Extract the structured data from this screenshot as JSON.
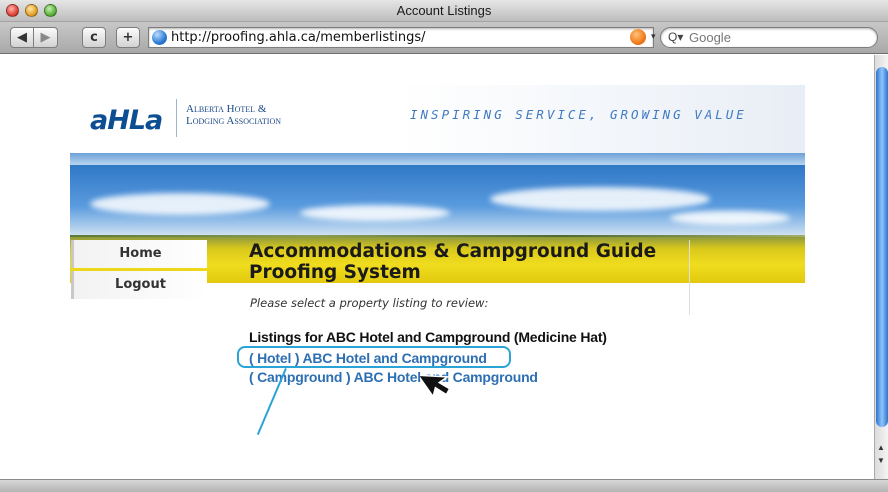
{
  "window": {
    "title": "Account Listings"
  },
  "toolbar": {
    "back_label": "◀",
    "forward_label": "▶",
    "reload_label": "c",
    "add_label": "+",
    "url": "http://proofing.ahla.ca/memberlistings/",
    "search_placeholder": "Google"
  },
  "site": {
    "logo_text": "aHLa",
    "org_name_line1": "Alberta Hotel &",
    "org_name_line2": "Lodging Association",
    "tagline": "INSPIRING SERVICE, GROWING VALUE"
  },
  "nav": {
    "items": [
      {
        "label": "Home"
      },
      {
        "label": "Logout"
      }
    ]
  },
  "main": {
    "title": "Accommodations & Campground Guide Proofing System",
    "subtitle": "Please select a property listing to review:",
    "listing_heading": "Listings for ABC Hotel and Campground (Medicine Hat)",
    "listings": [
      {
        "label": "( Hotel ) ABC Hotel and Campground"
      },
      {
        "label": "( Campground ) ABC Hotel and Campground"
      }
    ]
  },
  "colors": {
    "link": "#2d6fb3",
    "annotation": "#2aa3d6",
    "brand_blue": "#0d4d91"
  },
  "icons": [
    "globe-icon",
    "rss-icon",
    "search-icon",
    "mouse-cursor-icon"
  ]
}
